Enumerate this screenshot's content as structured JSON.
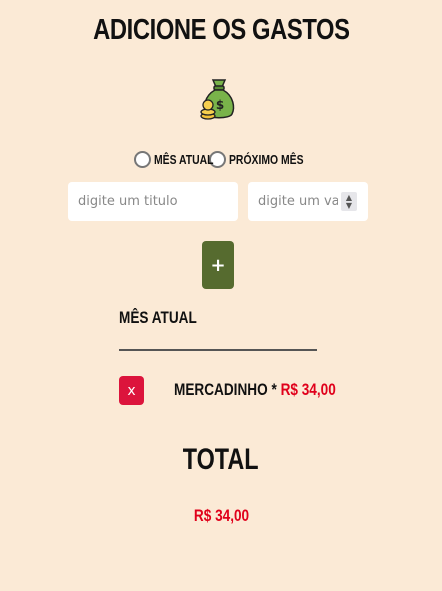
{
  "header": {
    "title": "ADICIONE OS GASTOS",
    "icon": "money-bag-icon"
  },
  "period": {
    "options": [
      {
        "label": "MÊS ATUAL",
        "selected": false
      },
      {
        "label": "PRÓXIMO MÊS",
        "selected": false
      }
    ]
  },
  "form": {
    "title_placeholder": "digite um titulo",
    "value_placeholder": "digite um valor",
    "add_label": "+"
  },
  "expenses": {
    "section_title": "MÊS ATUAL",
    "items": [
      {
        "delete_label": "x",
        "name": "MERCADINHO",
        "separator": "*",
        "value": "R$ 34,00"
      }
    ]
  },
  "total": {
    "label": "TOTAL",
    "value": "R$ 34,00"
  },
  "colors": {
    "background": "#fbead6",
    "add_button": "#566b2f",
    "delete_button": "#dc143c",
    "money": "#e0001b"
  }
}
